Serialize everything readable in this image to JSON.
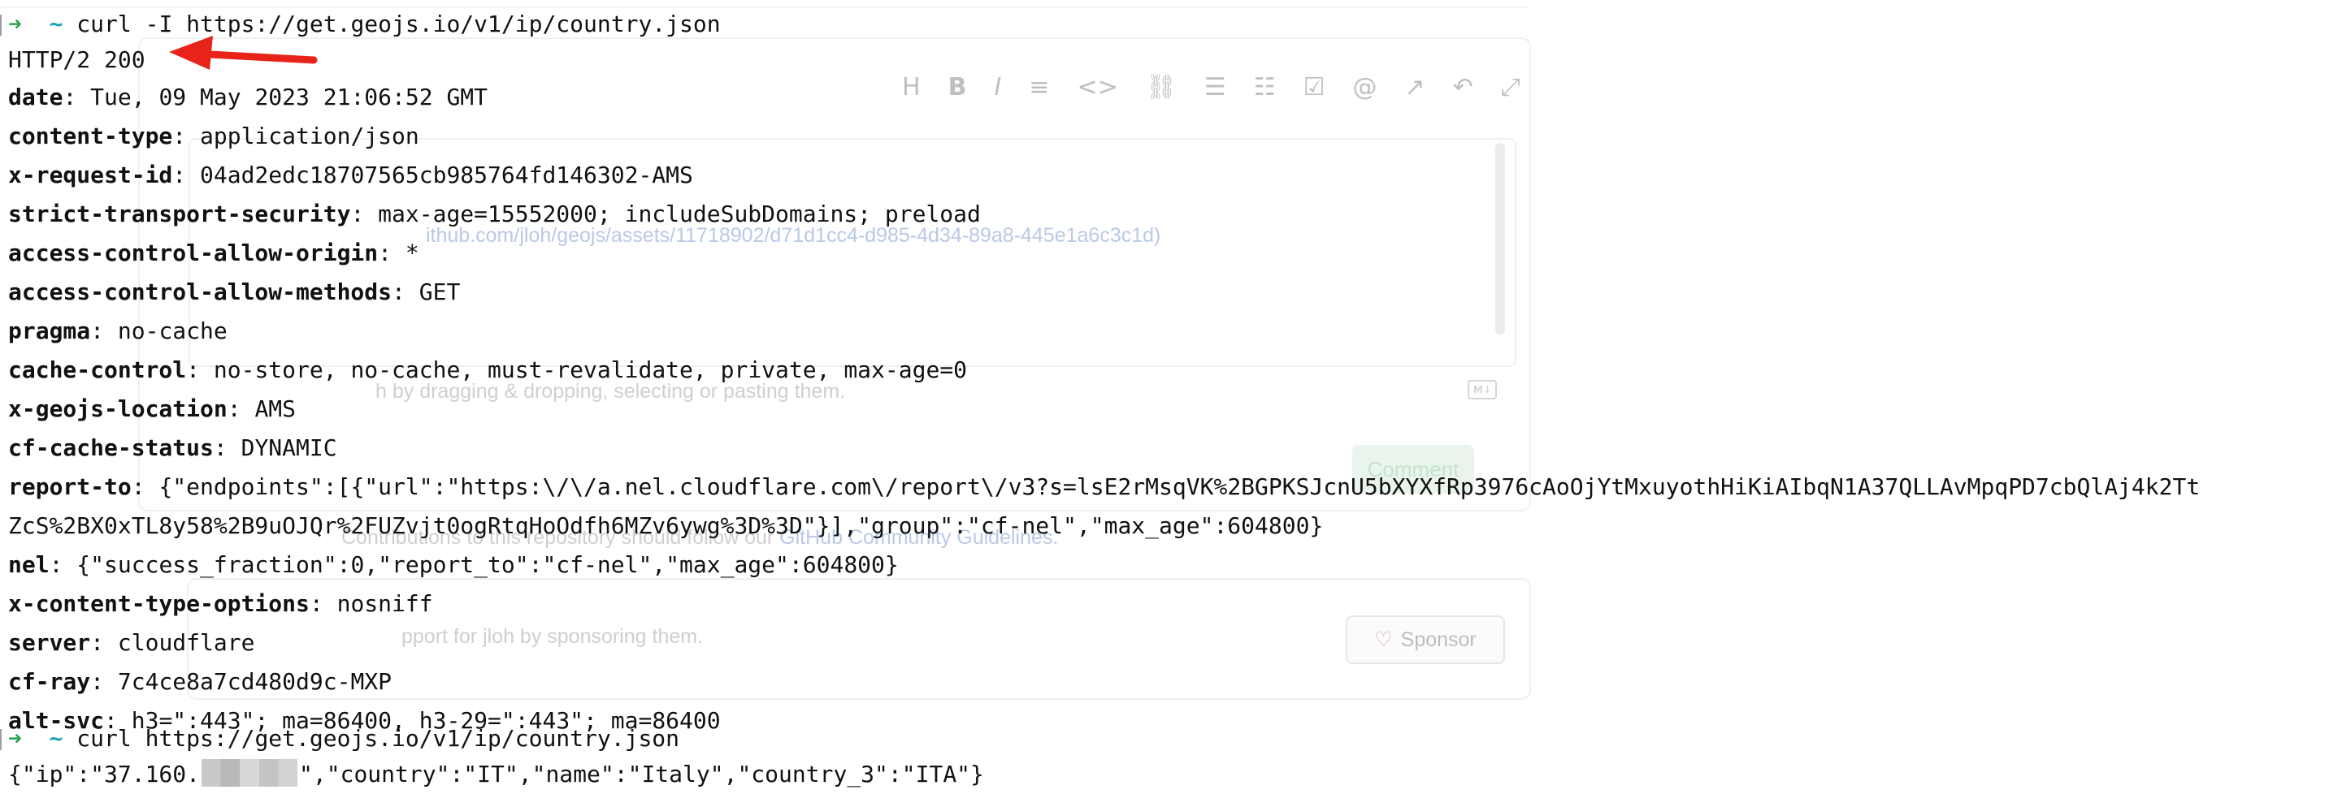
{
  "terminal": {
    "prompt_arrow": "➜",
    "prompt_tilde": "~",
    "cmd1": "curl -I https://get.geojs.io/v1/ip/country.json",
    "status_line": "HTTP/2 200",
    "headers": [
      {
        "key": "date",
        "value": "Tue, 09 May 2023 21:06:52 GMT"
      },
      {
        "key": "content-type",
        "value": "application/json"
      },
      {
        "key": "x-request-id",
        "value": "04ad2edc18707565cb985764fd146302-AMS"
      },
      {
        "key": "strict-transport-security",
        "value": "max-age=15552000; includeSubDomains; preload"
      },
      {
        "key": "access-control-allow-origin",
        "value": "*"
      },
      {
        "key": "access-control-allow-methods",
        "value": "GET"
      },
      {
        "key": "pragma",
        "value": "no-cache"
      },
      {
        "key": "cache-control",
        "value": "no-store, no-cache, must-revalidate, private, max-age=0"
      },
      {
        "key": "x-geojs-location",
        "value": "AMS"
      },
      {
        "key": "cf-cache-status",
        "value": "DYNAMIC"
      },
      {
        "key": "report-to",
        "value": "{\"endpoints\":[{\"url\":\"https:\\/\\/a.nel.cloudflare.com\\/report\\/v3?s=lsE2rMsqVK%2BGPKSJcnU5bXYXfRp3976cAoOjYtMxuyothHiKiAIbqN1A37QLLAvMpqPD7cbQlAj4k2Tt"
      },
      {
        "key": "",
        "value": "ZcS%2BX0xTL8y58%2B9uOJQr%2FUZvjt0ogRtqHoOdfh6MZv6ywg%3D%3D\"}],\"group\":\"cf-nel\",\"max_age\":604800}"
      },
      {
        "key": "nel",
        "value": "{\"success_fraction\":0,\"report_to\":\"cf-nel\",\"max_age\":604800}"
      },
      {
        "key": "x-content-type-options",
        "value": "nosniff"
      },
      {
        "key": "server",
        "value": "cloudflare"
      },
      {
        "key": "cf-ray",
        "value": "7c4ce8a7cd480d9c-MXP"
      },
      {
        "key": "alt-svc",
        "value": "h3=\":443\"; ma=86400, h3-29=\":443\"; ma=86400"
      }
    ],
    "cmd2": "curl https://get.geojs.io/v1/ip/country.json",
    "output_prefix": "{\"ip\":\"37.160.",
    "output_suffix": "\",\"country\":\"IT\",\"name\":\"Italy\",\"country_3\":\"ITA\"}"
  },
  "background_page": {
    "toolbar_icons": [
      "heading-icon",
      "bold-icon",
      "italic-icon",
      "quote-icon",
      "code-icon",
      "link-icon",
      "bulleted-list-icon",
      "numbered-list-icon",
      "task-list-icon",
      "mention-icon",
      "reference-icon",
      "reply-icon",
      "fullscreen-icon"
    ],
    "attachment_link": "ithub.com/jloh/geojs/assets/11718902/d71d1cc4-d985-4d34-89a8-445e1a6c3c1d)",
    "attach_hint": "h by dragging & dropping, selecting or pasting them.",
    "comment_button": "Comment",
    "guidelines_prefix": "Contributions to this repository should follow our ",
    "guidelines_link": "GitHub Community Guidelines.",
    "sponsor_text_prefix": "pport for ",
    "sponsor_user": "jloh",
    "sponsor_text_suffix": " by sponsoring them.",
    "sponsor_button": "Sponsor"
  },
  "colors": {
    "annotation_arrow": "#e8231a",
    "prompt_arrow": "#2da44e",
    "prompt_tilde": "#22a0b5"
  }
}
